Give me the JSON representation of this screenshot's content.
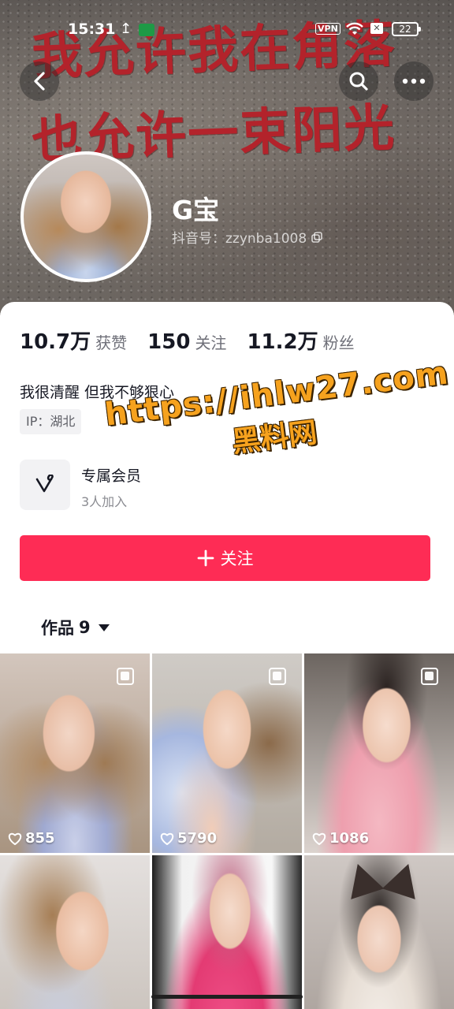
{
  "banner": {
    "line1": "我允许我在角落",
    "line2": "也允许一束阳光"
  },
  "status_bar": {
    "time": "15:31",
    "app_badge": "oppo",
    "vpn": "VPN",
    "battery": "22"
  },
  "profile": {
    "nickname": "G宝",
    "douyin_id": "抖音号：zzynba1008"
  },
  "stats": [
    {
      "value": "10.7万",
      "label": "获赞"
    },
    {
      "value": "150",
      "label": "关注"
    },
    {
      "value": "11.2万",
      "label": "粉丝"
    }
  ],
  "bio": "我很清醒 但我不够狠心",
  "ip_tag": "IP：湖北",
  "membership": {
    "title": "专属会员",
    "subtitle": "3人加入"
  },
  "follow_button": {
    "label": "关注"
  },
  "works_tab": {
    "label": "作品",
    "count": "9"
  },
  "videos": [
    {
      "likes": "855",
      "multi": true
    },
    {
      "likes": "5790",
      "multi": true
    },
    {
      "likes": "1086",
      "multi": true
    },
    {
      "likes": "",
      "multi": false
    },
    {
      "likes": "",
      "multi": false
    },
    {
      "likes": "",
      "multi": false
    }
  ],
  "watermark": {
    "url": "https://ihlw27.com",
    "name": "黑料网"
  },
  "colors": {
    "accent": "#fe2c55",
    "watermark": "#f6a21e"
  },
  "icons": [
    "back-arrow-icon",
    "search-icon",
    "more-icon",
    "copy-icon",
    "member-v-icon",
    "plus-icon",
    "caret-down-icon",
    "heart-icon",
    "multi-image-icon"
  ]
}
